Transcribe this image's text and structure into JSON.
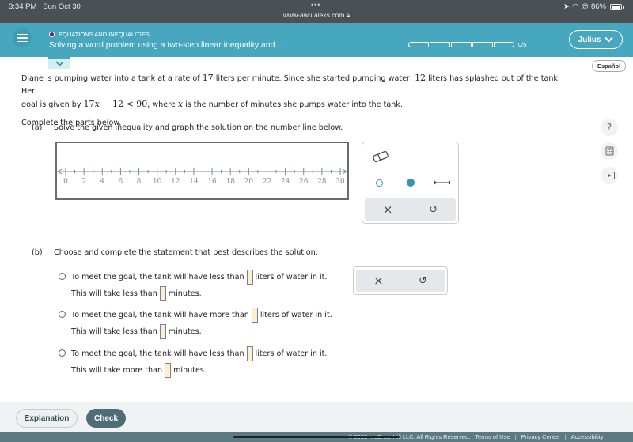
{
  "statusbar": {
    "time": "3:34 PM",
    "date": "Sun Oct 30",
    "url": "www-awu.aleks.com",
    "battery": "86%"
  },
  "header": {
    "topic": "EQUATIONS AND INEQUALITIES",
    "title": "Solving a word problem using a two-step linear inequality and...",
    "progress": {
      "completed": 0,
      "total": 5,
      "label": "0/5"
    },
    "user": "Julius",
    "colors": {
      "header_bg": "#46a7bf",
      "topic_dot": "#6a1b6e"
    }
  },
  "espanol_label": "Español",
  "problem": {
    "line1_a": "Diane is pumping water into a tank at a rate of ",
    "rate": "17",
    "line1_b": " liters per minute. Since she started pumping water, ",
    "splash": "12",
    "line1_c": " liters has splashed out of the tank. Her",
    "line2_a": "goal is given by ",
    "ineq_a": "17",
    "ineq_var": "x",
    "ineq_b": " − 12 < 90",
    "line2_b": ", where ",
    "var": "x",
    "line2_c": " is the number of minutes she pumps water into the tank.",
    "instruction": "Complete the parts below."
  },
  "part_a": {
    "label": "(a)",
    "text": "Solve the given inequality and graph the solution on the number line below.",
    "number_line": {
      "min": 0,
      "max": 30,
      "minor_step": 1,
      "labels": [
        "0",
        "2",
        "4",
        "6",
        "8",
        "10",
        "12",
        "14",
        "16",
        "18",
        "20",
        "22",
        "24",
        "26",
        "28",
        "30"
      ]
    },
    "tools": {
      "eraser": "eraser-icon",
      "open_point": "open-circle-icon",
      "closed_point": "closed-circle-icon",
      "segment": "segment-icon",
      "clear": "×",
      "undo": "↺"
    }
  },
  "part_b": {
    "label": "(b)",
    "text": "Choose and complete the statement that best describes the solution.",
    "options": [
      {
        "line1_a": "To meet the goal, the tank will have less than",
        "line1_b": "liters of water in it.",
        "line2_a": "This will take less than",
        "line2_b": "minutes.",
        "value1": "",
        "value2": ""
      },
      {
        "line1_a": "To meet the goal, the tank will have more than",
        "line1_b": "liters of water in it.",
        "line2_a": "This will take less than",
        "line2_b": "minutes.",
        "value1": "",
        "value2": ""
      },
      {
        "line1_a": "To meet the goal, the tank will have less than",
        "line1_b": "liters of water in it.",
        "line2_a": "This will take more than",
        "line2_b": "minutes.",
        "value1": "",
        "value2": ""
      }
    ],
    "clear": "×",
    "undo": "↺"
  },
  "side_tools": {
    "help": "?",
    "calculator": "calculator-icon",
    "video": "video-icon"
  },
  "footer": {
    "explanation": "Explanation",
    "check": "Check",
    "copyright": "© 2022 McGraw Hill LLC. All Rights Reserved.",
    "links": [
      "Terms of Use",
      "Privacy Center",
      "Accessibility"
    ]
  }
}
